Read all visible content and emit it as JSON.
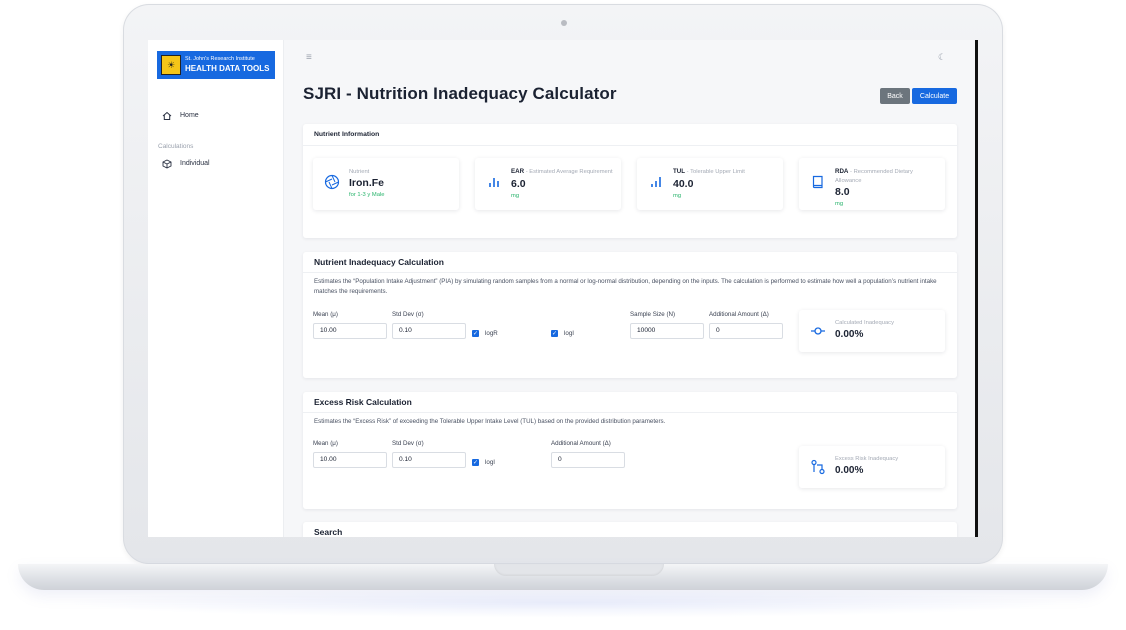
{
  "sidebar": {
    "logo_line1": "St. John's Research Institute",
    "logo_line2": "HEALTH DATA TOOLS",
    "home_label": "Home",
    "section_label": "Calculations",
    "individual_label": "Individual"
  },
  "header": {
    "title": "SJRI - Nutrition Inadequacy Calculator",
    "back_label": "Back",
    "calculate_label": "Calculate"
  },
  "nutrient_info": {
    "header": "Nutrient Information",
    "nutrient": {
      "label": "Nutrient",
      "value": "Iron.Fe",
      "sub": "for 1-3 y Male"
    },
    "ear": {
      "abbr": "EAR",
      "desc": "- Estimated Average Requirement",
      "value": "6.0",
      "unit": "mg"
    },
    "tul": {
      "abbr": "TUL",
      "desc": "- Tolerable Upper Limit",
      "value": "40.0",
      "unit": "mg"
    },
    "rda": {
      "abbr": "RDA",
      "desc": "- Recommended Dietary Allowance",
      "value": "8.0",
      "unit": "mg"
    }
  },
  "inadequacy": {
    "title": "Nutrient Inadequacy Calculation",
    "description": "Estimates the “Population Intake Adjustment” (PIA) by simulating random samples from a normal or log-normal distribution, depending on the inputs. The calculation is performed to estimate how well a population’s nutrient intake matches the requirements.",
    "mean_label": "Mean (μ)",
    "mean_value": "10.00",
    "sd_label": "Std Dev (σ)",
    "sd_value": "0.10",
    "logR_label": "logR",
    "logI_label": "logI",
    "sample_label": "Sample Size (N)",
    "sample_value": "10000",
    "additional_label": "Additional Amount (Δ)",
    "additional_value": "0",
    "result_label": "Calculated Inadequacy",
    "result_value": "0.00%"
  },
  "excess": {
    "title": "Excess Risk Calculation",
    "description": "Estimates the “Excess Risk” of exceeding the Tolerable Upper Intake Level (TUL) based on the provided distribution parameters.",
    "mean_label": "Mean (μ)",
    "mean_value": "10.00",
    "sd_label": "Std Dev (σ)",
    "sd_value": "0.10",
    "logI_label": "logI",
    "additional_label": "Additional Amount (Δ)",
    "additional_value": "0",
    "result_label": "Excess Risk Inadequacy",
    "result_value": "0.00%"
  },
  "search": {
    "title": "Search"
  },
  "colors": {
    "accent": "#1769e0",
    "success": "#28b46c",
    "secondary": "#6c757d"
  }
}
